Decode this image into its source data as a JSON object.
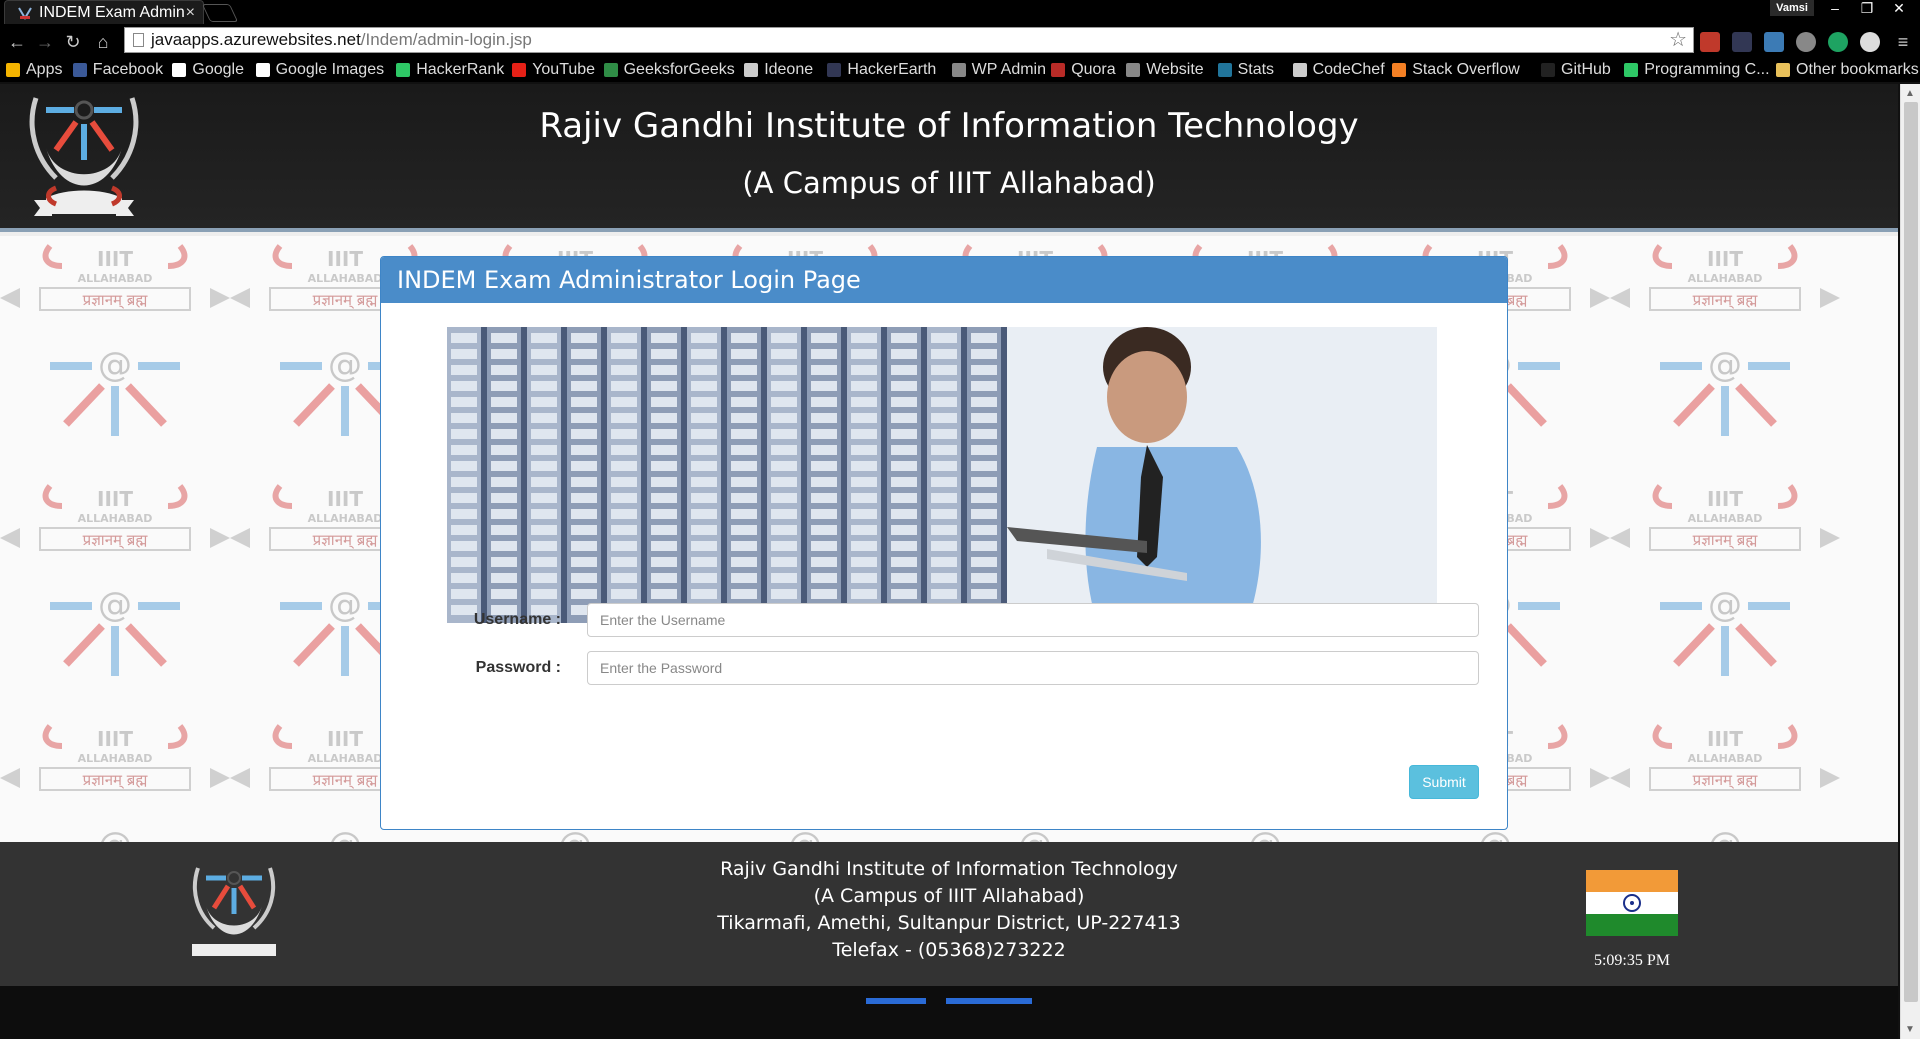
{
  "browser": {
    "tab_title": "INDEM Exam Admin",
    "tab_close": "×",
    "user_name": "Vamsi",
    "window_buttons": [
      "–",
      "❐",
      "✕"
    ],
    "url_host": "javaapps.azurewebsites.net",
    "url_path": "/Indem/admin-login.jsp",
    "bookmarks": [
      {
        "label": "Apps",
        "color": "#f4b400"
      },
      {
        "label": "Facebook",
        "color": "#3b5998"
      },
      {
        "label": "Google",
        "color": "#ffffff"
      },
      {
        "label": "Google Images",
        "color": "#ffffff"
      },
      {
        "label": "HackerRank",
        "color": "#2ec866"
      },
      {
        "label": "YouTube",
        "color": "#e62117"
      },
      {
        "label": "GeeksforGeeks",
        "color": "#2f8d46"
      },
      {
        "label": "Ideone",
        "color": "#cccccc"
      },
      {
        "label": "HackerEarth",
        "color": "#323754"
      },
      {
        "label": "WP Admin",
        "color": "#888888"
      },
      {
        "label": "Quora",
        "color": "#b92b27"
      },
      {
        "label": "Website",
        "color": "#888888"
      },
      {
        "label": "Stats",
        "color": "#21759b"
      },
      {
        "label": "CodeChef",
        "color": "#cccccc"
      },
      {
        "label": "Stack Overflow",
        "color": "#f48024"
      },
      {
        "label": "GitHub",
        "color": "#222222"
      },
      {
        "label": "Programming C...",
        "color": "#2ec866"
      }
    ],
    "bookmarks_overflow": "»",
    "other_bookmarks": "Other bookmarks"
  },
  "header": {
    "title": "Rajiv Gandhi Institute of Information Technology",
    "subtitle": "(A Campus of IIIT Allahabad)",
    "logo_motto": "प्रज्ञानम् ब्रह्म"
  },
  "pattern": {
    "tile_text": "IIIT",
    "tile_sub": "ALLAHABAD",
    "tile_motto": "प्रज्ञानम् ब्रह्म",
    "tile_at": "@"
  },
  "login": {
    "panel_title": "INDEM Exam Administrator Login Page",
    "username_label": "Username :",
    "username_placeholder": "Enter the Username",
    "password_label": "Password :",
    "password_placeholder": "Enter the Password",
    "submit_label": "Submit"
  },
  "footer": {
    "line1": "Rajiv Gandhi Institute of Information Technology",
    "line2": "(A Campus of IIIT Allahabad)",
    "line3": "Tikarmafi, Amethi, Sultanpur District, UP-227413",
    "line4": "Telefax - (05368)273222",
    "clock": "5:09:35 PM",
    "logo_motto": "प्रज्ञानम् ब्रह्म"
  },
  "colors": {
    "panel_header": "#4a8cc9",
    "submit": "#5bc0de",
    "header_bg": "#1a1a1a",
    "footer_bg": "#333333"
  }
}
